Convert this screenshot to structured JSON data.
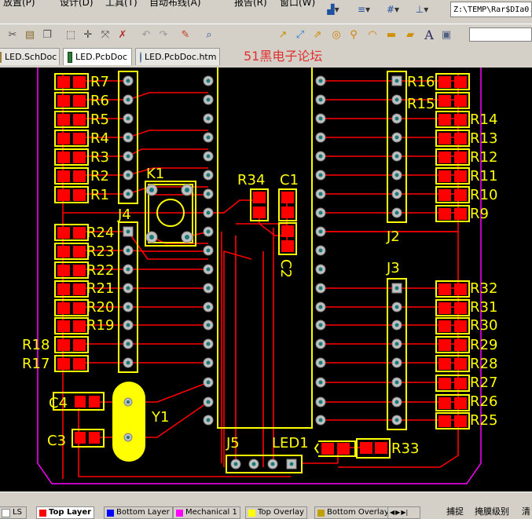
{
  "menubar": {
    "items": [
      "放置(P)",
      "设计(D)",
      "工具(T)",
      "自动布线(A)",
      "报告(R)",
      "窗口(W)"
    ],
    "path_text": "Z:\\TEMP\\Rar$DIa0."
  },
  "tabs": [
    {
      "label": "LED.SchDoc",
      "active": false
    },
    {
      "label": "LED.PcbDoc",
      "active": true
    },
    {
      "label": "LED.PcbDoc.htm",
      "active": false
    }
  ],
  "banner": "51黑电子论坛",
  "board": {
    "refdes_left": [
      "R7",
      "R6",
      "R5",
      "R4",
      "R3",
      "R2",
      "R1",
      "R24",
      "R23",
      "R22",
      "R21",
      "R20",
      "R19",
      "R18",
      "R17"
    ],
    "refdes_right": [
      "R16",
      "R15",
      "R14",
      "R13",
      "R12",
      "R11",
      "R10",
      "R9",
      "R32",
      "R31",
      "R30",
      "R29",
      "R28",
      "R27",
      "R26",
      "R25"
    ],
    "refdes_misc": {
      "k1": "K1",
      "j4": "J4",
      "r34": "R34",
      "c1": "C1",
      "c2": "C2",
      "j2": "J2",
      "j3": "J3",
      "c4": "C4",
      "c3": "C3",
      "y1": "Y1",
      "j5": "J5",
      "led1": "LED1",
      "r33": "R33"
    }
  },
  "layer_tabs": [
    {
      "label": "LS",
      "color": "#ffffff"
    },
    {
      "label": "Top Layer",
      "color": "#ff0000"
    },
    {
      "label": "Bottom Layer",
      "color": "#0000ff"
    },
    {
      "label": "Mechanical 1",
      "color": "#ff00ff"
    },
    {
      "label": "Top Overlay",
      "color": "#ffff00"
    },
    {
      "label": "Bottom Overlay",
      "color": "#c0a000"
    }
  ],
  "status": {
    "snap": "捕捉",
    "mask": "掩膜级别",
    "clear": "清"
  },
  "colors": {
    "track": "#ff0000",
    "overlay": "#ffff00",
    "pad": "#c0c0c0",
    "board_outline": "#ff00ff"
  }
}
